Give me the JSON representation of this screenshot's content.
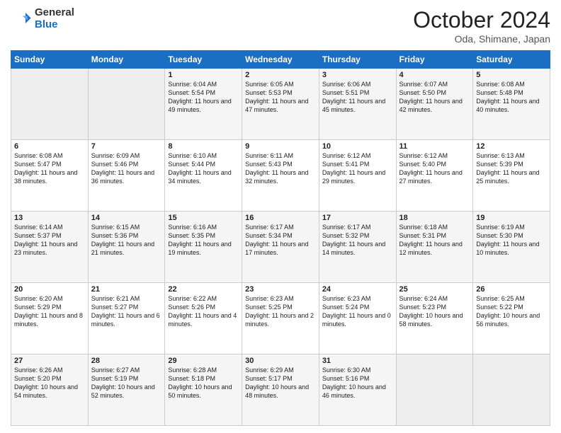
{
  "header": {
    "logo_general": "General",
    "logo_blue": "Blue",
    "month_title": "October 2024",
    "location": "Oda, Shimane, Japan"
  },
  "days_of_week": [
    "Sunday",
    "Monday",
    "Tuesday",
    "Wednesday",
    "Thursday",
    "Friday",
    "Saturday"
  ],
  "weeks": [
    [
      {
        "day": "",
        "info": ""
      },
      {
        "day": "",
        "info": ""
      },
      {
        "day": "1",
        "info": "Sunrise: 6:04 AM\nSunset: 5:54 PM\nDaylight: 11 hours and 49 minutes."
      },
      {
        "day": "2",
        "info": "Sunrise: 6:05 AM\nSunset: 5:53 PM\nDaylight: 11 hours and 47 minutes."
      },
      {
        "day": "3",
        "info": "Sunrise: 6:06 AM\nSunset: 5:51 PM\nDaylight: 11 hours and 45 minutes."
      },
      {
        "day": "4",
        "info": "Sunrise: 6:07 AM\nSunset: 5:50 PM\nDaylight: 11 hours and 42 minutes."
      },
      {
        "day": "5",
        "info": "Sunrise: 6:08 AM\nSunset: 5:48 PM\nDaylight: 11 hours and 40 minutes."
      }
    ],
    [
      {
        "day": "6",
        "info": "Sunrise: 6:08 AM\nSunset: 5:47 PM\nDaylight: 11 hours and 38 minutes."
      },
      {
        "day": "7",
        "info": "Sunrise: 6:09 AM\nSunset: 5:46 PM\nDaylight: 11 hours and 36 minutes."
      },
      {
        "day": "8",
        "info": "Sunrise: 6:10 AM\nSunset: 5:44 PM\nDaylight: 11 hours and 34 minutes."
      },
      {
        "day": "9",
        "info": "Sunrise: 6:11 AM\nSunset: 5:43 PM\nDaylight: 11 hours and 32 minutes."
      },
      {
        "day": "10",
        "info": "Sunrise: 6:12 AM\nSunset: 5:41 PM\nDaylight: 11 hours and 29 minutes."
      },
      {
        "day": "11",
        "info": "Sunrise: 6:12 AM\nSunset: 5:40 PM\nDaylight: 11 hours and 27 minutes."
      },
      {
        "day": "12",
        "info": "Sunrise: 6:13 AM\nSunset: 5:39 PM\nDaylight: 11 hours and 25 minutes."
      }
    ],
    [
      {
        "day": "13",
        "info": "Sunrise: 6:14 AM\nSunset: 5:37 PM\nDaylight: 11 hours and 23 minutes."
      },
      {
        "day": "14",
        "info": "Sunrise: 6:15 AM\nSunset: 5:36 PM\nDaylight: 11 hours and 21 minutes."
      },
      {
        "day": "15",
        "info": "Sunrise: 6:16 AM\nSunset: 5:35 PM\nDaylight: 11 hours and 19 minutes."
      },
      {
        "day": "16",
        "info": "Sunrise: 6:17 AM\nSunset: 5:34 PM\nDaylight: 11 hours and 17 minutes."
      },
      {
        "day": "17",
        "info": "Sunrise: 6:17 AM\nSunset: 5:32 PM\nDaylight: 11 hours and 14 minutes."
      },
      {
        "day": "18",
        "info": "Sunrise: 6:18 AM\nSunset: 5:31 PM\nDaylight: 11 hours and 12 minutes."
      },
      {
        "day": "19",
        "info": "Sunrise: 6:19 AM\nSunset: 5:30 PM\nDaylight: 11 hours and 10 minutes."
      }
    ],
    [
      {
        "day": "20",
        "info": "Sunrise: 6:20 AM\nSunset: 5:29 PM\nDaylight: 11 hours and 8 minutes."
      },
      {
        "day": "21",
        "info": "Sunrise: 6:21 AM\nSunset: 5:27 PM\nDaylight: 11 hours and 6 minutes."
      },
      {
        "day": "22",
        "info": "Sunrise: 6:22 AM\nSunset: 5:26 PM\nDaylight: 11 hours and 4 minutes."
      },
      {
        "day": "23",
        "info": "Sunrise: 6:23 AM\nSunset: 5:25 PM\nDaylight: 11 hours and 2 minutes."
      },
      {
        "day": "24",
        "info": "Sunrise: 6:23 AM\nSunset: 5:24 PM\nDaylight: 11 hours and 0 minutes."
      },
      {
        "day": "25",
        "info": "Sunrise: 6:24 AM\nSunset: 5:23 PM\nDaylight: 10 hours and 58 minutes."
      },
      {
        "day": "26",
        "info": "Sunrise: 6:25 AM\nSunset: 5:22 PM\nDaylight: 10 hours and 56 minutes."
      }
    ],
    [
      {
        "day": "27",
        "info": "Sunrise: 6:26 AM\nSunset: 5:20 PM\nDaylight: 10 hours and 54 minutes."
      },
      {
        "day": "28",
        "info": "Sunrise: 6:27 AM\nSunset: 5:19 PM\nDaylight: 10 hours and 52 minutes."
      },
      {
        "day": "29",
        "info": "Sunrise: 6:28 AM\nSunset: 5:18 PM\nDaylight: 10 hours and 50 minutes."
      },
      {
        "day": "30",
        "info": "Sunrise: 6:29 AM\nSunset: 5:17 PM\nDaylight: 10 hours and 48 minutes."
      },
      {
        "day": "31",
        "info": "Sunrise: 6:30 AM\nSunset: 5:16 PM\nDaylight: 10 hours and 46 minutes."
      },
      {
        "day": "",
        "info": ""
      },
      {
        "day": "",
        "info": ""
      }
    ]
  ]
}
